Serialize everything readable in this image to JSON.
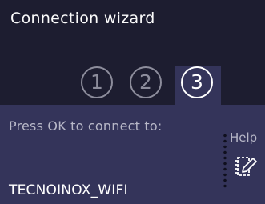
{
  "header": {
    "title": "Connection wizard"
  },
  "steps": [
    {
      "label": "1",
      "state": "inactive"
    },
    {
      "label": "2",
      "state": "inactive"
    },
    {
      "label": "3",
      "state": "active"
    }
  ],
  "panel": {
    "prompt": "Press OK to connect to:",
    "network_name": "TECNOINOX_WIFI"
  },
  "help": {
    "label": "Help",
    "icon": "note-edit-icon"
  },
  "colors": {
    "background": "#1d1d30",
    "panel": "#34345a",
    "inactive_step": "#8d8d9c",
    "active_step": "#ffffff"
  }
}
